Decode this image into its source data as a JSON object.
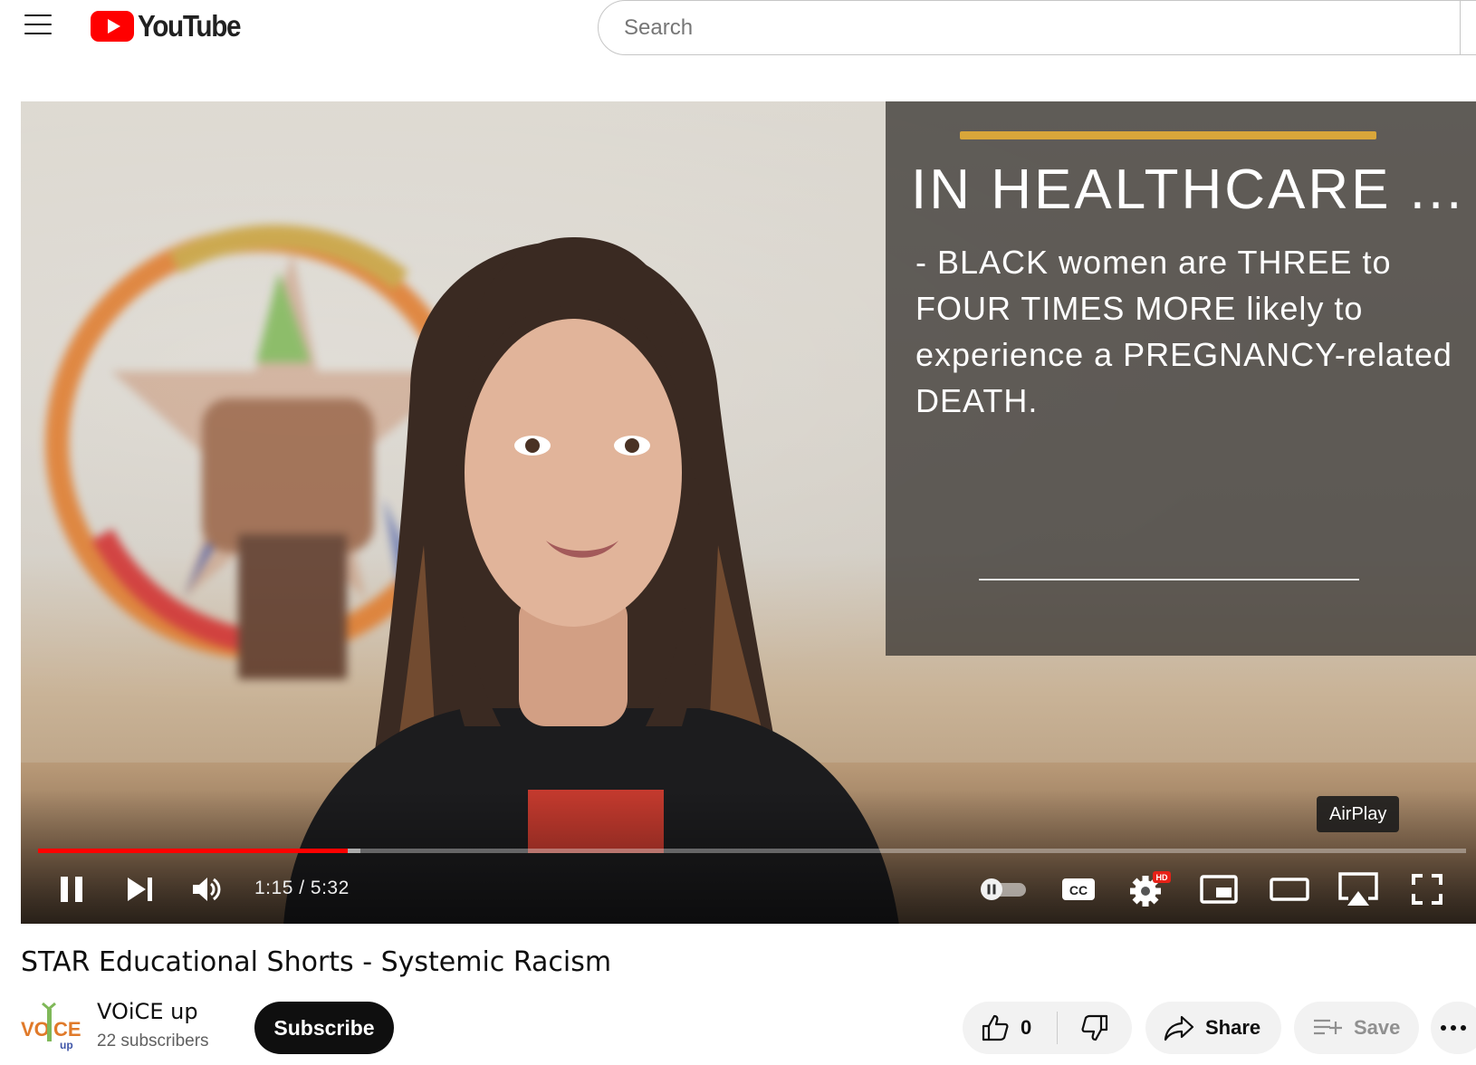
{
  "masthead": {
    "menu_icon": "hamburger-menu-icon",
    "logo_text": "YouTube",
    "search": {
      "placeholder": "Search",
      "value": ""
    }
  },
  "player": {
    "overlay": {
      "title": "IN HEALTHCARE ...",
      "body": "- BLACK women are THREE to FOUR TIMES MORE likely to experience a PREGNANCY-related DEATH.",
      "accent_color": "#d9a63a"
    },
    "tooltip": "AirPlay",
    "progress": {
      "played_fraction": 0.217,
      "loaded_fraction": 0.226,
      "played_color": "#ff0000"
    },
    "time": {
      "current": "1:15",
      "separator": " / ",
      "duration": "5:32"
    },
    "controls": {
      "left": [
        "pause-icon",
        "next-icon",
        "volume-icon"
      ],
      "right": [
        "autoplay-toggle-icon",
        "captions-icon",
        "settings-icon",
        "miniplayer-icon",
        "theater-icon",
        "airplay-icon",
        "fullscreen-icon"
      ]
    },
    "settings_badge": "HD"
  },
  "video": {
    "title": "STAR Educational Shorts - Systemic Racism"
  },
  "channel": {
    "name": "VOiCE up",
    "subscribers": "22 subscribers",
    "avatar_text_top": "VO",
    "avatar_text_mid": "CE",
    "avatar_text_bottom": "up",
    "subscribe_label": "Subscribe"
  },
  "actions": {
    "like_count": "0",
    "share_label": "Share",
    "save_label": "Save"
  }
}
